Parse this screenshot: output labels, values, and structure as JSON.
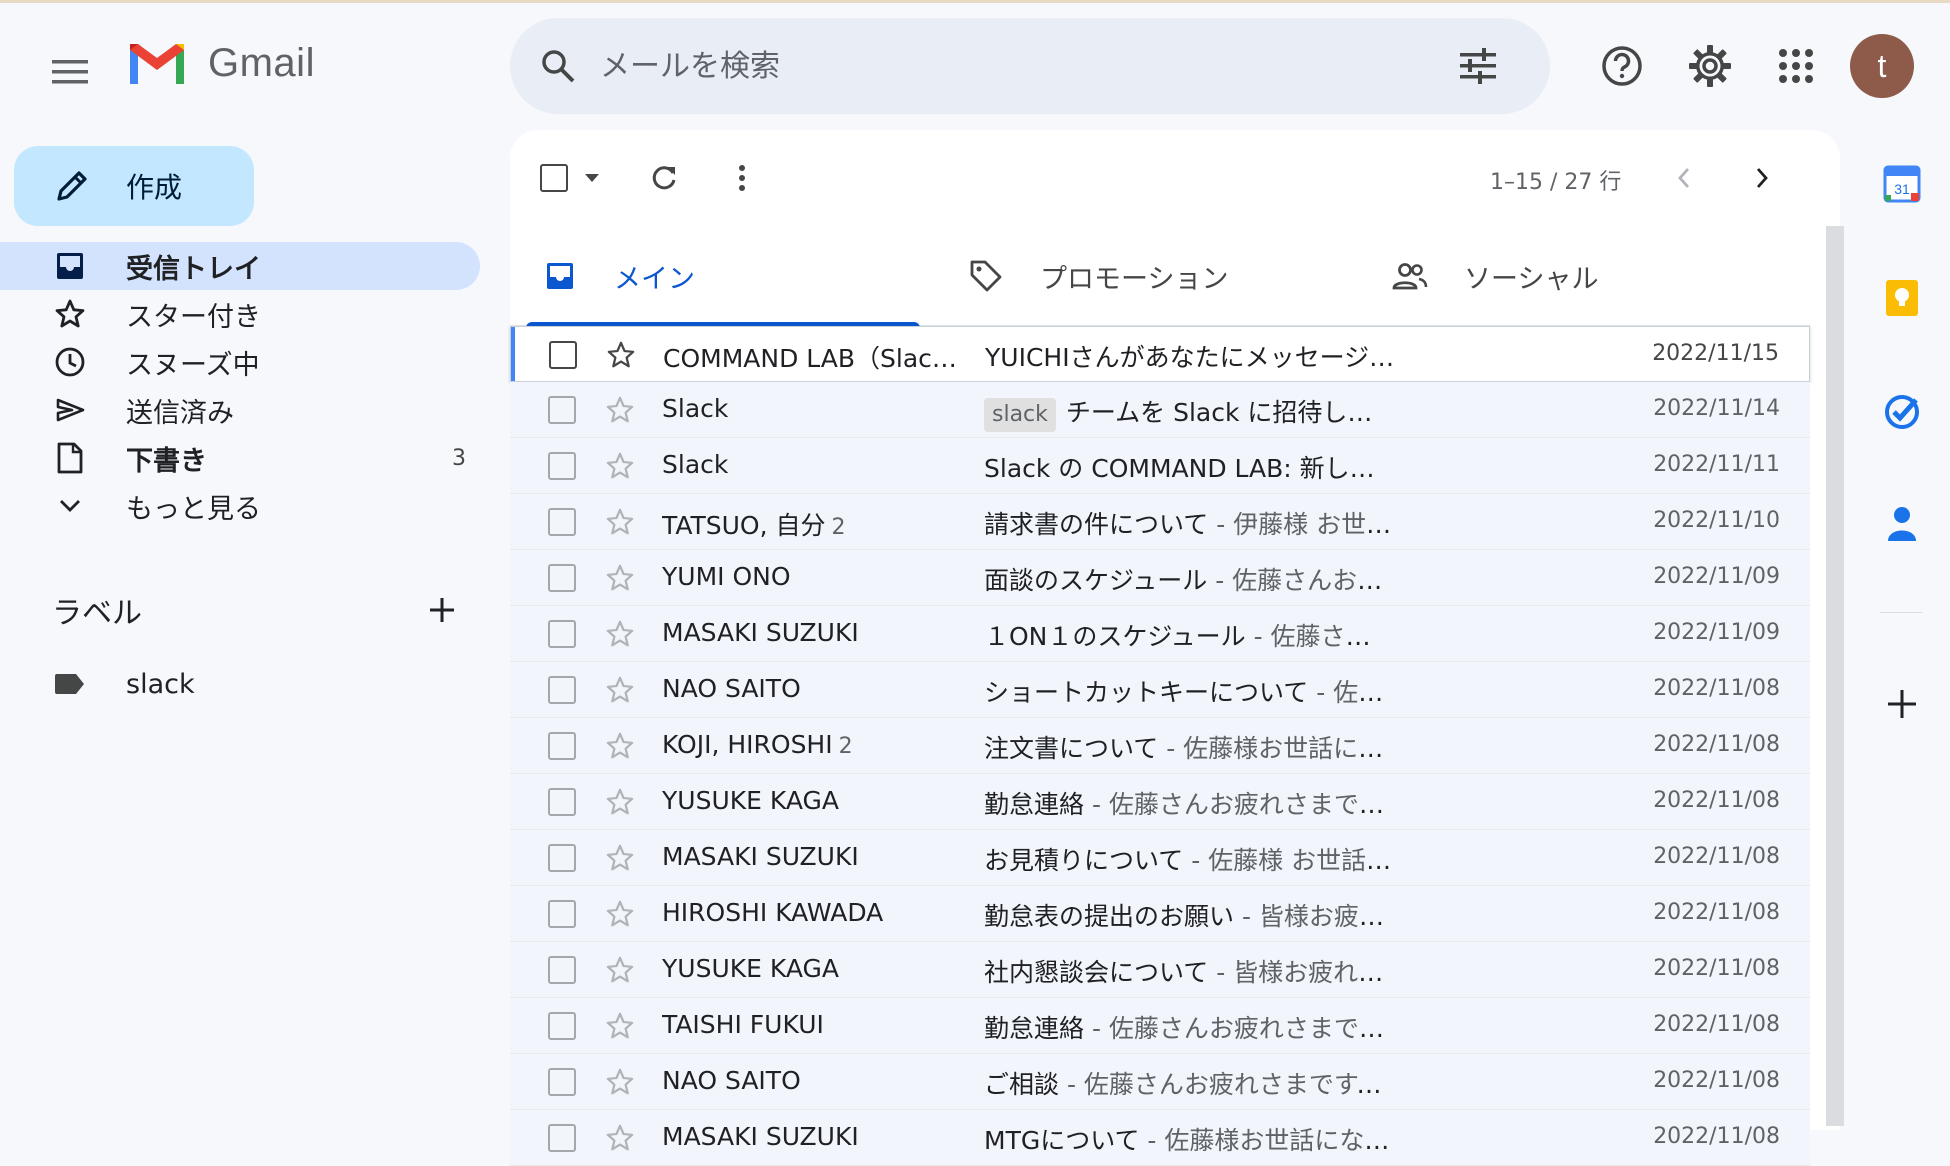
{
  "app": {
    "name": "Gmail"
  },
  "search": {
    "placeholder": "メールを検索"
  },
  "colors": {
    "accent": "#0b57d0",
    "compose_bg": "#c2e7ff",
    "active_nav_bg": "#d3e3fd",
    "avatar_bg": "#8e5a4a"
  },
  "header": {
    "avatar_letter": "t"
  },
  "compose": {
    "label": "作成"
  },
  "nav": {
    "items": [
      {
        "label": "受信トレイ",
        "icon": "inbox-icon",
        "active": true
      },
      {
        "label": "スター付き",
        "icon": "star-icon"
      },
      {
        "label": "スヌーズ中",
        "icon": "clock-icon"
      },
      {
        "label": "送信済み",
        "icon": "send-icon"
      },
      {
        "label": "下書き",
        "icon": "draft-icon",
        "count": "3"
      },
      {
        "label": "もっと見る",
        "icon": "chevron-down-icon"
      }
    ]
  },
  "labels": {
    "title": "ラベル",
    "items": [
      {
        "label": "slack"
      }
    ]
  },
  "toolbar": {
    "page_info": "1–15 / 27 行"
  },
  "tabs": [
    {
      "label": "メイン",
      "icon": "inbox-icon"
    },
    {
      "label": "プロモーション",
      "icon": "tag-icon"
    },
    {
      "label": "ソーシャル",
      "icon": "people-icon"
    }
  ],
  "emails": [
    {
      "sender": "COMMAND LAB（Slack ...",
      "count": "",
      "chip": "",
      "subject": "YUICHIさんがあなたにメッセージを送...",
      "snippet": "",
      "date": "2022/11/15"
    },
    {
      "sender": "Slack",
      "count": "",
      "chip": "slack",
      "subject": "チームを Slack に招待しましょう",
      "snippet": " - ",
      "date": "2022/11/14"
    },
    {
      "sender": "Slack",
      "count": "",
      "chip": "",
      "subject": "Slack の COMMAND LAB: 新しいアカウ...",
      "snippet": "",
      "date": "2022/11/11"
    },
    {
      "sender": "TATSUO, 自分",
      "count": "2",
      "chip": "",
      "subject": "請求書の件について",
      "snippet": " - 伊藤様 お世話に...",
      "date": "2022/11/10"
    },
    {
      "sender": "YUMI ONO",
      "count": "",
      "chip": "",
      "subject": "面談のスケジュール",
      "snippet": " - 佐藤さんお疲れ...",
      "date": "2022/11/09"
    },
    {
      "sender": "MASAKI SUZUKI",
      "count": "",
      "chip": "",
      "subject": "１ON１のスケジュール",
      "snippet": " - 佐藤さんお疲...",
      "date": "2022/11/09"
    },
    {
      "sender": "NAO SAITO",
      "count": "",
      "chip": "",
      "subject": "ショートカットキーについて",
      "snippet": " - 佐藤様...",
      "date": "2022/11/08"
    },
    {
      "sender": "KOJI, HIROSHI",
      "count": "2",
      "chip": "",
      "subject": "注文書について",
      "snippet": " - 佐藤様お世話になっ...",
      "date": "2022/11/08"
    },
    {
      "sender": "YUSUKE KAGA",
      "count": "",
      "chip": "",
      "subject": "勤怠連絡",
      "snippet": " - 佐藤さんお疲れさまです。 ...",
      "date": "2022/11/08"
    },
    {
      "sender": "MASAKI SUZUKI",
      "count": "",
      "chip": "",
      "subject": "お見積りについて",
      "snippet": " - 佐藤様 お世話にな...",
      "date": "2022/11/08"
    },
    {
      "sender": "HIROSHI KAWADA",
      "count": "",
      "chip": "",
      "subject": "勤怠表の提出のお願い",
      "snippet": " - 皆様お疲れさ...",
      "date": "2022/11/08"
    },
    {
      "sender": "YUSUKE KAGA",
      "count": "",
      "chip": "",
      "subject": "社内懇談会について",
      "snippet": " - 皆様お疲れさま...",
      "date": "2022/11/08"
    },
    {
      "sender": "TAISHI FUKUI",
      "count": "",
      "chip": "",
      "subject": "勤怠連絡",
      "snippet": " - 佐藤さんお疲れさまです。 ...",
      "date": "2022/11/08"
    },
    {
      "sender": "NAO SAITO",
      "count": "",
      "chip": "",
      "subject": "ご相談",
      "snippet": " - 佐藤さんお疲れさまです。 斎...",
      "date": "2022/11/08"
    },
    {
      "sender": "MASAKI SUZUKI",
      "count": "",
      "chip": "",
      "subject": "MTGについて",
      "snippet": " - 佐藤様お世話になってい...",
      "date": "2022/11/08"
    }
  ]
}
